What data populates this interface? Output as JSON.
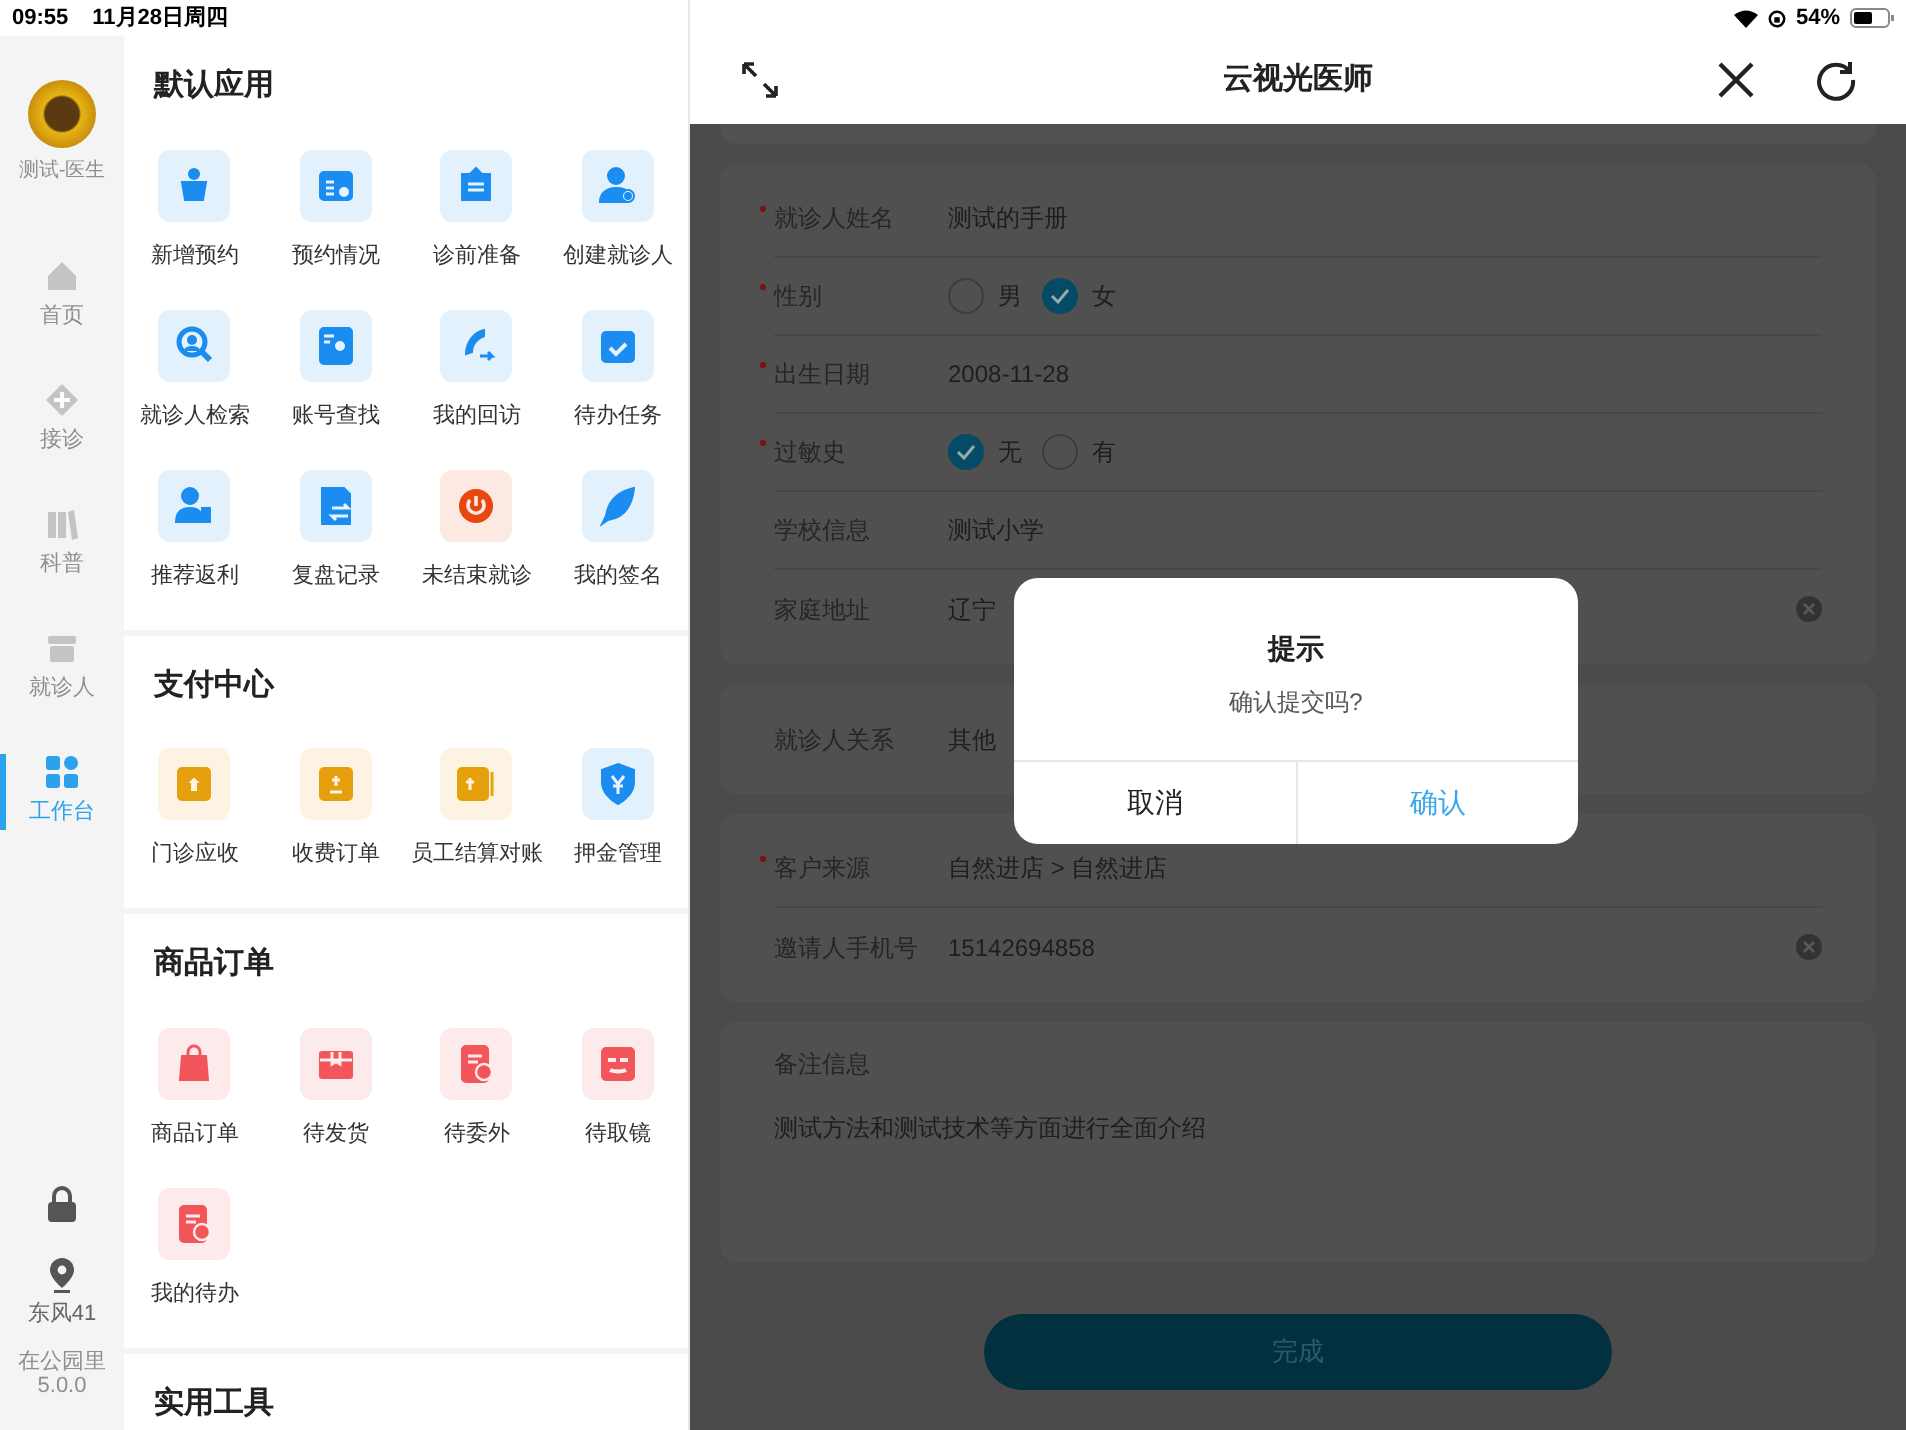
{
  "status_bar": {
    "time": "09:55",
    "date": "11月28日周四",
    "battery": "54%"
  },
  "rail": {
    "user": "测试-医生",
    "items": [
      {
        "label": "首页",
        "selected": false
      },
      {
        "label": "接诊",
        "selected": false
      },
      {
        "label": "科普",
        "selected": false
      },
      {
        "label": "就诊人",
        "selected": false
      },
      {
        "label": "工作台",
        "selected": true
      }
    ],
    "location": "东风41",
    "store": "在公园里",
    "version": "5.0.0"
  },
  "sections": [
    {
      "title": "默认应用",
      "apps": [
        {
          "label": "新增预约",
          "color": "#1b8cf0"
        },
        {
          "label": "预约情况",
          "color": "#1b8cf0"
        },
        {
          "label": "诊前准备",
          "color": "#1b8cf0"
        },
        {
          "label": "创建就诊人",
          "color": "#1b8cf0"
        },
        {
          "label": "就诊人检索",
          "color": "#1b8cf0"
        },
        {
          "label": "账号查找",
          "color": "#1b8cf0"
        },
        {
          "label": "我的回访",
          "color": "#1b8cf0"
        },
        {
          "label": "待办任务",
          "color": "#1b8cf0"
        },
        {
          "label": "推荐返利",
          "color": "#1b8cf0"
        },
        {
          "label": "复盘记录",
          "color": "#1b8cf0"
        },
        {
          "label": "未结束就诊",
          "color": "#e8470f"
        },
        {
          "label": "我的签名",
          "color": "#1b8cf0"
        }
      ]
    },
    {
      "title": "支付中心",
      "apps": [
        {
          "label": "门诊应收",
          "color": "#e6a00e"
        },
        {
          "label": "收费订单",
          "color": "#e6a00e"
        },
        {
          "label": "员工结算对账",
          "color": "#e6a00e"
        },
        {
          "label": "押金管理",
          "color": "#1b8cf0"
        }
      ]
    },
    {
      "title": "商品订单",
      "apps": [
        {
          "label": "商品订单",
          "color": "#f2555a"
        },
        {
          "label": "待发货",
          "color": "#f2555a"
        },
        {
          "label": "待委外",
          "color": "#f2555a"
        },
        {
          "label": "待取镜",
          "color": "#f2555a"
        },
        {
          "label": "我的待办",
          "color": "#f2555a"
        }
      ]
    },
    {
      "title": "实用工具"
    }
  ],
  "header": {
    "title": "云视光医师"
  },
  "form_cards": [
    {
      "rows": [
        {
          "kind": "text",
          "label": "就诊人姓名",
          "required": true,
          "value": "测试的手册"
        },
        {
          "kind": "radio",
          "label": "性别",
          "required": true,
          "options": [
            {
              "label": "男",
              "selected": false
            },
            {
              "label": "女",
              "selected": true
            }
          ]
        },
        {
          "kind": "text",
          "label": "出生日期",
          "required": true,
          "value": "2008-11-28"
        },
        {
          "kind": "radio",
          "label": "过敏史",
          "required": true,
          "options": [
            {
              "label": "无",
              "selected": true
            },
            {
              "label": "有",
              "selected": false
            }
          ]
        },
        {
          "kind": "text",
          "label": "学校信息",
          "required": false,
          "value": "测试小学"
        },
        {
          "kind": "clearable",
          "label": "家庭地址",
          "required": false,
          "value": "辽宁"
        }
      ]
    },
    {
      "rows": [
        {
          "kind": "text",
          "label": "就诊人关系",
          "required": false,
          "value": "其他"
        }
      ]
    },
    {
      "rows": [
        {
          "kind": "text",
          "label": "客户来源",
          "required": true,
          "value": "自然进店 > 自然进店"
        },
        {
          "kind": "clearable",
          "label": "邀请人手机号",
          "required": false,
          "value": "15142694858"
        }
      ]
    },
    {
      "rows": [
        {
          "kind": "note",
          "label": "备注信息",
          "value": "测试方法和测试技术等方面进行全面介绍"
        }
      ]
    }
  ],
  "submit_button": "完成",
  "dialog": {
    "title": "提示",
    "message": "确认提交吗?",
    "cancel": "取消",
    "confirm": "确认"
  }
}
